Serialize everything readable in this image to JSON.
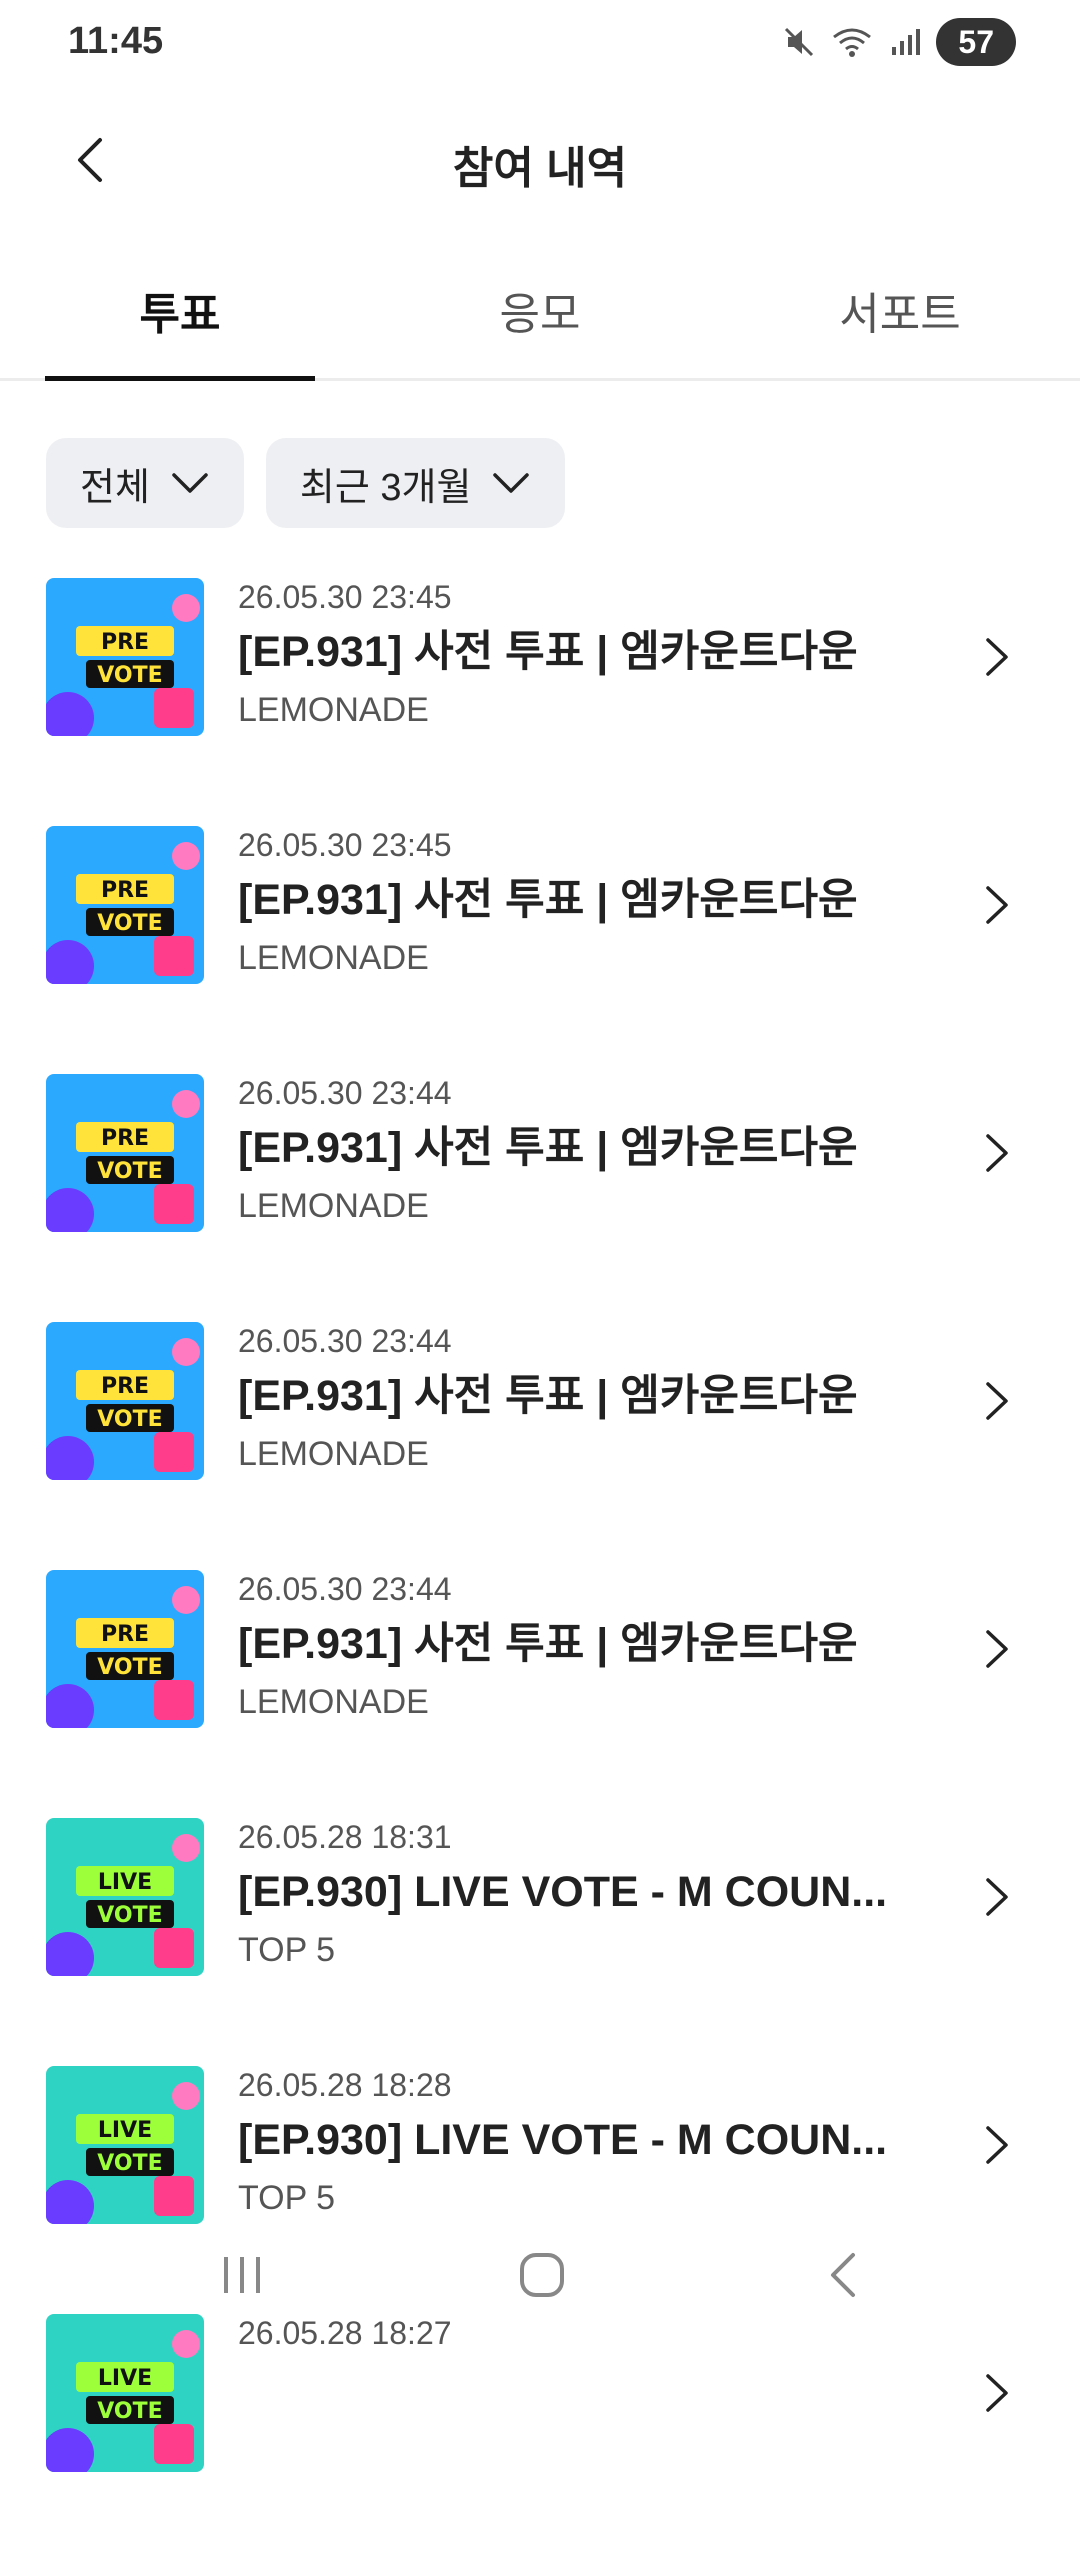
{
  "status_bar": {
    "time": "11:45",
    "battery": "57",
    "icons": [
      "mute-icon",
      "wifi-icon",
      "signal-icon"
    ]
  },
  "header": {
    "title": "참여 내역",
    "back_icon": "back-arrow-icon"
  },
  "tabs": [
    {
      "label": "투표",
      "active": true
    },
    {
      "label": "응모",
      "active": false
    },
    {
      "label": "서포트",
      "active": false
    }
  ],
  "filters": [
    {
      "label": "전체",
      "icon": "chevron-down-icon"
    },
    {
      "label": "최근 3개월",
      "icon": "chevron-down-icon"
    }
  ],
  "items": [
    {
      "date": "26.05.30 23:45",
      "title": "[EP.931] 사전 투표 | 엠카운트다운",
      "subtitle": "LEMONADE",
      "badge": [
        "PRE",
        "VOTE"
      ]
    },
    {
      "date": "26.05.30 23:45",
      "title": "[EP.931] 사전 투표 | 엠카운트다운",
      "subtitle": "LEMONADE",
      "badge": [
        "PRE",
        "VOTE"
      ]
    },
    {
      "date": "26.05.30 23:44",
      "title": "[EP.931] 사전 투표 | 엠카운트다운",
      "subtitle": "LEMONADE",
      "badge": [
        "PRE",
        "VOTE"
      ]
    },
    {
      "date": "26.05.30 23:44",
      "title": "[EP.931] 사전 투표 | 엠카운트다운",
      "subtitle": "LEMONADE",
      "badge": [
        "PRE",
        "VOTE"
      ]
    },
    {
      "date": "26.05.30 23:44",
      "title": "[EP.931] 사전 투표 | 엠카운트다운",
      "subtitle": "LEMONADE",
      "badge": [
        "PRE",
        "VOTE"
      ]
    },
    {
      "date": "26.05.28 18:31",
      "title": "[EP.930] LIVE VOTE - M COUN...",
      "subtitle": "TOP 5",
      "badge": [
        "LIVE",
        "VOTE"
      ]
    },
    {
      "date": "26.05.28 18:28",
      "title": "[EP.930] LIVE VOTE - M COUN...",
      "subtitle": "TOP 5",
      "badge": [
        "LIVE",
        "VOTE"
      ]
    },
    {
      "date": "26.05.28 18:27",
      "title": "",
      "subtitle": "",
      "badge": [
        "LIVE",
        "VOTE"
      ]
    }
  ],
  "nav": [
    "recent-apps-icon",
    "home-icon",
    "back-icon"
  ]
}
